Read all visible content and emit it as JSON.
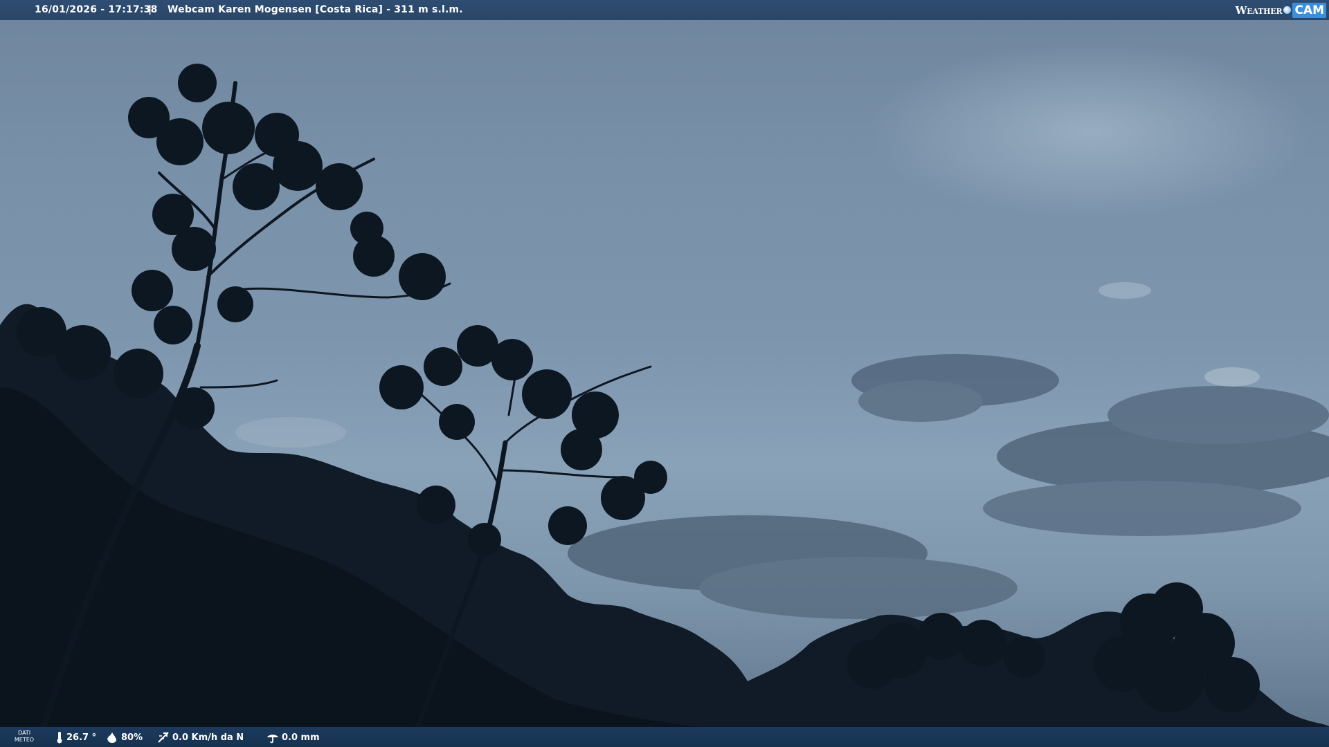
{
  "header": {
    "timestamp": "16/01/2026 - 17:17:38",
    "separator": "|",
    "webcam_title": "Webcam Karen Mogensen [Costa Rica]  - 311 m s.l.m."
  },
  "logo": {
    "word": "Weather",
    "suffix": "CAM",
    "icon": "globe-icon",
    "color": "#3a8fdc"
  },
  "footer": {
    "dati_line1": "DATI",
    "dati_line2": "METEO",
    "temperature": "26.7 °",
    "humidity": "80%",
    "wind": "0.0 Km/h da N",
    "rain": "0.0 mm",
    "icons": [
      "thermometer-icon",
      "humidity-drop-icon",
      "wind-icon",
      "rain-gauge-icon"
    ]
  },
  "colors": {
    "bar_background": "#2a4668",
    "sky": "#7d95ad",
    "silhouette": "#0d1722"
  }
}
